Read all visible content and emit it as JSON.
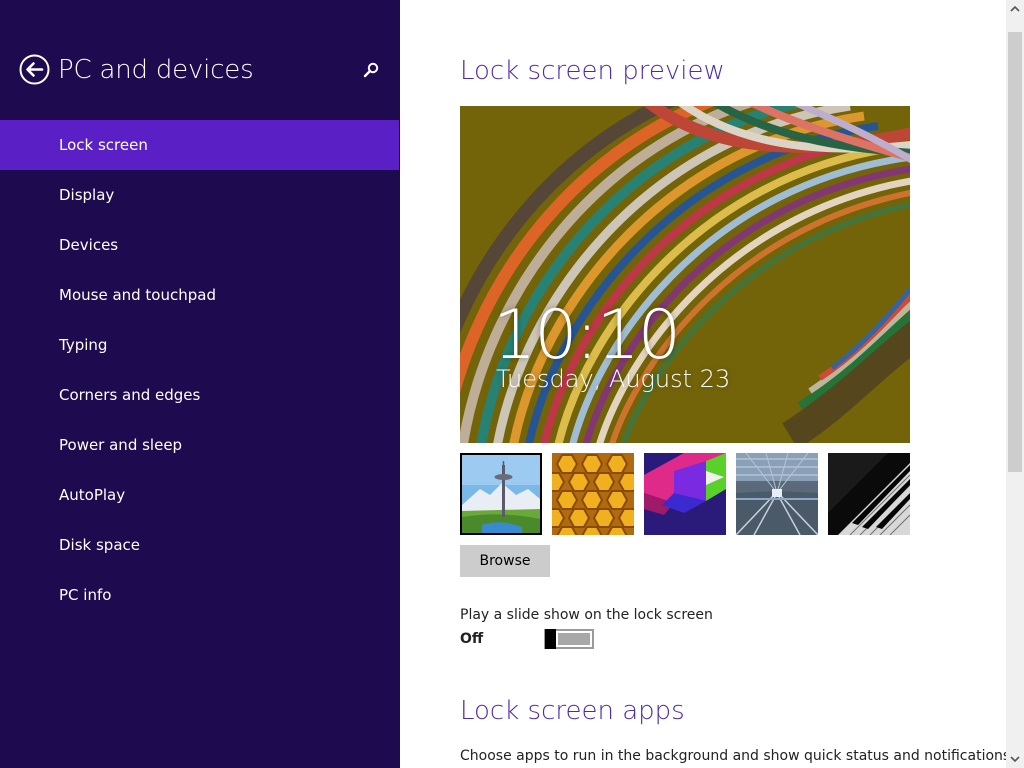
{
  "sidebar": {
    "title": "PC and devices",
    "back_icon": "back-arrow-circle-icon",
    "search_icon": "search-icon",
    "items": [
      {
        "label": "Lock screen",
        "selected": true
      },
      {
        "label": "Display",
        "selected": false
      },
      {
        "label": "Devices",
        "selected": false
      },
      {
        "label": "Mouse and touchpad",
        "selected": false
      },
      {
        "label": "Typing",
        "selected": false
      },
      {
        "label": "Corners and edges",
        "selected": false
      },
      {
        "label": "Power and sleep",
        "selected": false
      },
      {
        "label": "AutoPlay",
        "selected": false
      },
      {
        "label": "Disk space",
        "selected": false
      },
      {
        "label": "PC info",
        "selected": false
      }
    ]
  },
  "main": {
    "preview_heading": "Lock screen preview",
    "preview": {
      "time": "10:10",
      "date": "Tuesday, August 23"
    },
    "thumbnails": [
      {
        "name": "space-needle-landscape",
        "selected": true
      },
      {
        "name": "honeycomb",
        "selected": false
      },
      {
        "name": "colored-geometric-shapes",
        "selected": false
      },
      {
        "name": "train-tunnel",
        "selected": false
      },
      {
        "name": "piano-keys",
        "selected": false
      }
    ],
    "browse_label": "Browse",
    "slideshow": {
      "label": "Play a slide show on the lock screen",
      "state": "Off",
      "on": false
    },
    "apps_heading": "Lock screen apps",
    "apps_description": "Choose apps to run in the background and show quick status and notifications,"
  },
  "colors": {
    "sidebar_bg": "#1e0a4e",
    "selected_item": "#5b20c5",
    "heading": "#4f2aa8"
  }
}
